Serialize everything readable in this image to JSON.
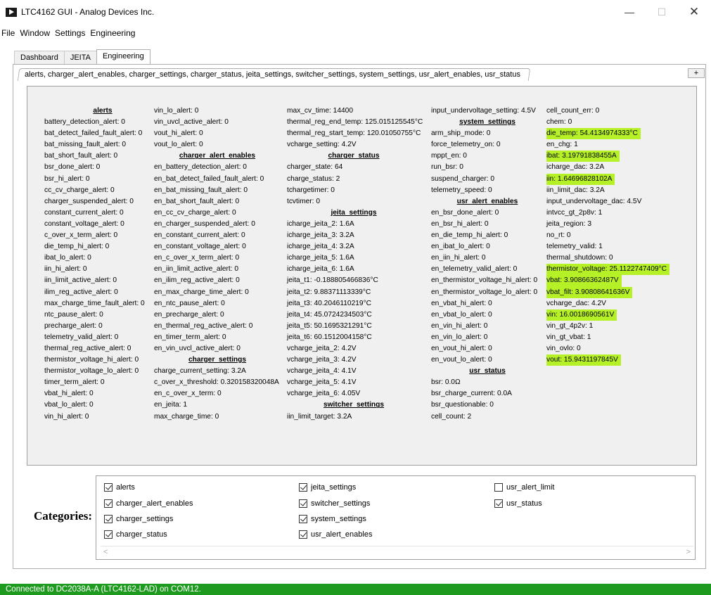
{
  "window": {
    "title": "LTC4162 GUI - Analog Devices Inc.",
    "min_glyph": "—",
    "max_glyph": "☐",
    "close_glyph": "✕"
  },
  "menu": [
    "File",
    "Window",
    "Settings",
    "Engineering"
  ],
  "tabs": [
    {
      "label": "Dashboard",
      "active": false
    },
    {
      "label": "JEITA",
      "active": false
    },
    {
      "label": "Engineering",
      "active": true
    }
  ],
  "category_tab": "alerts, charger_alert_enables, charger_settings, charger_status, jeita_settings, switcher_settings, system_settings, usr_alert_enables, usr_status",
  "plus_label": "+",
  "highlight_color": "#b6f026",
  "status_color": "#1e9b1e",
  "columns": [
    [
      {
        "t": "alerts",
        "h": true
      },
      {
        "t": "battery_detection_alert: 0"
      },
      {
        "t": "bat_detect_failed_fault_alert: 0"
      },
      {
        "t": "bat_missing_fault_alert: 0"
      },
      {
        "t": "bat_short_fault_alert: 0"
      },
      {
        "t": "bsr_done_alert: 0"
      },
      {
        "t": "bsr_hi_alert: 0"
      },
      {
        "t": "cc_cv_charge_alert: 0"
      },
      {
        "t": "charger_suspended_alert: 0"
      },
      {
        "t": "constant_current_alert: 0"
      },
      {
        "t": "constant_voltage_alert: 0"
      },
      {
        "t": "c_over_x_term_alert: 0"
      },
      {
        "t": "die_temp_hi_alert: 0"
      },
      {
        "t": "ibat_lo_alert: 0"
      },
      {
        "t": "iin_hi_alert: 0"
      },
      {
        "t": "iin_limit_active_alert: 0"
      },
      {
        "t": "ilim_reg_active_alert: 0"
      },
      {
        "t": "max_charge_time_fault_alert: 0"
      },
      {
        "t": "ntc_pause_alert: 0"
      },
      {
        "t": "precharge_alert: 0"
      },
      {
        "t": "telemetry_valid_alert: 0"
      },
      {
        "t": "thermal_reg_active_alert: 0"
      },
      {
        "t": "thermistor_voltage_hi_alert: 0"
      },
      {
        "t": "thermistor_voltage_lo_alert: 0"
      },
      {
        "t": "timer_term_alert: 0"
      },
      {
        "t": "vbat_hi_alert: 0"
      },
      {
        "t": "vbat_lo_alert: 0"
      },
      {
        "t": "vin_hi_alert: 0"
      }
    ],
    [
      {
        "t": "vin_lo_alert: 0"
      },
      {
        "t": "vin_uvcl_active_alert: 0"
      },
      {
        "t": "vout_hi_alert: 0"
      },
      {
        "t": "vout_lo_alert: 0"
      },
      {
        "t": "charger_alert_enables",
        "h": true
      },
      {
        "t": "en_battery_detection_alert: 0"
      },
      {
        "t": "en_bat_detect_failed_fault_alert: 0"
      },
      {
        "t": "en_bat_missing_fault_alert: 0"
      },
      {
        "t": "en_bat_short_fault_alert: 0"
      },
      {
        "t": "en_cc_cv_charge_alert: 0"
      },
      {
        "t": "en_charger_suspended_alert: 0"
      },
      {
        "t": "en_constant_current_alert: 0"
      },
      {
        "t": "en_constant_voltage_alert: 0"
      },
      {
        "t": "en_c_over_x_term_alert: 0"
      },
      {
        "t": "en_iin_limit_active_alert: 0"
      },
      {
        "t": "en_ilim_reg_active_alert: 0"
      },
      {
        "t": "en_max_charge_time_alert: 0"
      },
      {
        "t": "en_ntc_pause_alert: 0"
      },
      {
        "t": "en_precharge_alert: 0"
      },
      {
        "t": "en_thermal_reg_active_alert: 0"
      },
      {
        "t": "en_timer_term_alert: 0"
      },
      {
        "t": "en_vin_uvcl_active_alert: 0"
      },
      {
        "t": "charger_settings",
        "h": true
      },
      {
        "t": "charge_current_setting: 3.2A"
      },
      {
        "t": "c_over_x_threshold: 0.320158320048A"
      },
      {
        "t": "en_c_over_x_term: 0"
      },
      {
        "t": "en_jeita: 1"
      },
      {
        "t": "max_charge_time: 0"
      }
    ],
    [
      {
        "t": "max_cv_time: 14400"
      },
      {
        "t": "thermal_reg_end_temp: 125.015125545°C"
      },
      {
        "t": "thermal_reg_start_temp: 120.01050755°C"
      },
      {
        "t": "vcharge_setting: 4.2V"
      },
      {
        "t": "charger_status",
        "h": true
      },
      {
        "t": "charger_state: 64"
      },
      {
        "t": "charge_status: 2"
      },
      {
        "t": "tchargetimer: 0"
      },
      {
        "t": "tcvtimer: 0"
      },
      {
        "t": "jeita_settings",
        "h": true
      },
      {
        "t": "icharge_jeita_2: 1.6A"
      },
      {
        "t": "icharge_jeita_3: 3.2A"
      },
      {
        "t": "icharge_jeita_4: 3.2A"
      },
      {
        "t": "icharge_jeita_5: 1.6A"
      },
      {
        "t": "icharge_jeita_6: 1.6A"
      },
      {
        "t": "jeita_t1: -0.188805466836°C"
      },
      {
        "t": "jeita_t2: 9.88371113339°C"
      },
      {
        "t": "jeita_t3: 40.2046110219°C"
      },
      {
        "t": "jeita_t4: 45.0724234503°C"
      },
      {
        "t": "jeita_t5: 50.1695321291°C"
      },
      {
        "t": "jeita_t6: 60.1512004158°C"
      },
      {
        "t": "vcharge_jeita_2: 4.2V"
      },
      {
        "t": "vcharge_jeita_3: 4.2V"
      },
      {
        "t": "vcharge_jeita_4: 4.1V"
      },
      {
        "t": "vcharge_jeita_5: 4.1V"
      },
      {
        "t": "vcharge_jeita_6: 4.05V"
      },
      {
        "t": "switcher_settings",
        "h": true
      },
      {
        "t": "iin_limit_target: 3.2A"
      }
    ],
    [
      {
        "t": "input_undervoltage_setting: 4.5V"
      },
      {
        "t": "system_settings",
        "h": true
      },
      {
        "t": "arm_ship_mode: 0"
      },
      {
        "t": "force_telemetry_on: 0"
      },
      {
        "t": "mppt_en: 0"
      },
      {
        "t": "run_bsr: 0"
      },
      {
        "t": "suspend_charger: 0"
      },
      {
        "t": "telemetry_speed: 0"
      },
      {
        "t": "usr_alert_enables",
        "h": true
      },
      {
        "t": "en_bsr_done_alert: 0"
      },
      {
        "t": "en_bsr_hi_alert: 0"
      },
      {
        "t": "en_die_temp_hi_alert: 0"
      },
      {
        "t": "en_ibat_lo_alert: 0"
      },
      {
        "t": "en_iin_hi_alert: 0"
      },
      {
        "t": "en_telemetry_valid_alert: 0"
      },
      {
        "t": "en_thermistor_voltage_hi_alert: 0"
      },
      {
        "t": "en_thermistor_voltage_lo_alert: 0"
      },
      {
        "t": "en_vbat_hi_alert: 0"
      },
      {
        "t": "en_vbat_lo_alert: 0"
      },
      {
        "t": "en_vin_hi_alert: 0"
      },
      {
        "t": "en_vin_lo_alert: 0"
      },
      {
        "t": "en_vout_hi_alert: 0"
      },
      {
        "t": "en_vout_lo_alert: 0"
      },
      {
        "t": "usr_status",
        "h": true
      },
      {
        "t": "bsr: 0.0Ω"
      },
      {
        "t": "bsr_charge_current: 0.0A"
      },
      {
        "t": "bsr_questionable: 0"
      },
      {
        "t": "cell_count: 2"
      }
    ],
    [
      {
        "t": "cell_count_err: 0"
      },
      {
        "t": "chem: 0"
      },
      {
        "t": "die_temp: 54.4134974333°C",
        "hl": true
      },
      {
        "t": "en_chg: 1"
      },
      {
        "t": "ibat: 3.19791838455A",
        "hl": true
      },
      {
        "t": "icharge_dac: 3.2A"
      },
      {
        "t": "iin: 1.64696828102A",
        "hl": true
      },
      {
        "t": "iin_limit_dac: 3.2A"
      },
      {
        "t": "input_undervoltage_dac: 4.5V"
      },
      {
        "t": "intvcc_gt_2p8v: 1"
      },
      {
        "t": "jeita_region: 3"
      },
      {
        "t": "no_rt: 0"
      },
      {
        "t": "telemetry_valid: 1"
      },
      {
        "t": "thermal_shutdown: 0"
      },
      {
        "t": "thermistor_voltage: 25.1122747409°C",
        "hl": true
      },
      {
        "t": "vbat: 3.90866362487V",
        "hl": true
      },
      {
        "t": "vbat_filt: 3.90808641636V",
        "hl": true
      },
      {
        "t": "vcharge_dac: 4.2V"
      },
      {
        "t": "vin: 16.0018690561V",
        "hl": true
      },
      {
        "t": "vin_gt_4p2v: 1"
      },
      {
        "t": "vin_gt_vbat: 1"
      },
      {
        "t": "vin_ovlo: 0"
      },
      {
        "t": "vout: 15.9431197845V",
        "hl": true
      }
    ]
  ],
  "categories_label": "Categories:",
  "checkboxes": [
    {
      "label": "alerts",
      "checked": true
    },
    {
      "label": "charger_alert_enables",
      "checked": true
    },
    {
      "label": "charger_settings",
      "checked": true
    },
    {
      "label": "charger_status",
      "checked": true
    },
    {
      "label": "jeita_settings",
      "checked": true
    },
    {
      "label": "switcher_settings",
      "checked": true
    },
    {
      "label": "system_settings",
      "checked": true
    },
    {
      "label": "usr_alert_enables",
      "checked": true
    },
    {
      "label": "usr_alert_limit",
      "checked": false
    },
    {
      "label": "usr_status",
      "checked": true
    }
  ],
  "scroll": {
    "left": "<",
    "right": ">"
  },
  "status_text": "Connected to DC2038A-A (LTC4162-LAD) on COM12."
}
